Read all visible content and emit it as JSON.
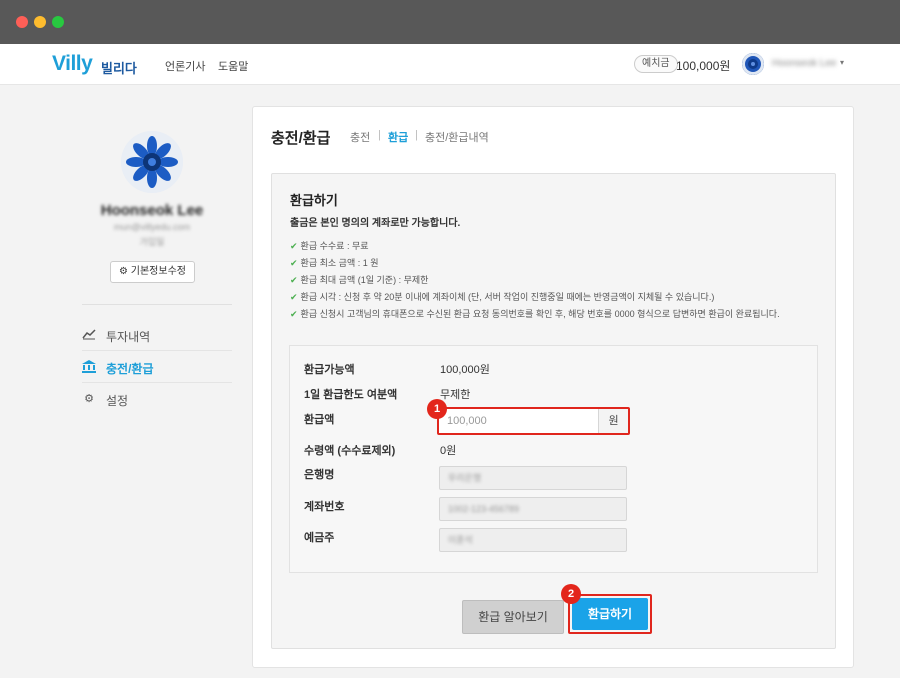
{
  "nav": {
    "logo": "Villy",
    "logo_sub": "빌리다",
    "links": [
      "언론기사",
      "도움말"
    ],
    "deposit_label": "예치금",
    "deposit_amount": "100,000원",
    "username": "Hoonseok Lee",
    "caret": "▾"
  },
  "sidebar": {
    "name": "Hoonseok Lee",
    "email": "mun@villyedu.com",
    "phone": "가입일",
    "edit_button": "기본정보수정",
    "menu": [
      {
        "label": "투자내역",
        "icon": "chart-icon"
      },
      {
        "label": "충전/환급",
        "icon": "bank-icon",
        "active": true
      },
      {
        "label": "설정",
        "icon": "gear-icon"
      }
    ]
  },
  "panel": {
    "title": "충전/환급",
    "tabs": [
      "충전",
      "환급",
      "충전/환급내역"
    ],
    "active_tab": "환급"
  },
  "refund": {
    "title": "환급하기",
    "notice": "출금은 본인 명의의 계좌로만 가능합니다.",
    "rules": [
      "환급 수수료 : 무료",
      "환급 최소 금액 : 1 원",
      "환급 최대 금액 (1일 기준) : 무제한",
      "환급 시각 : 신청 후 약 20분 이내에 계좌이체 (단, 서버 작업이 진행중일 때에는 반영금액이 지체될 수 있습니다.)",
      "환급 신청시 고객님의 휴대폰으로 수신된 환급 요청 동의번호를 확인 후, 해당 번호를 0000 형식으로 답변하면 환급이 완료됩니다."
    ],
    "form": {
      "available_label": "환급가능액",
      "available_value": "100,000원",
      "limit_label": "1일 환급한도 여분액",
      "limit_value": "무제한",
      "amount_label": "환급액",
      "amount_placeholder": "100,000",
      "amount_unit": "원",
      "received_label": "수령액 (수수료제외)",
      "received_value": "0원",
      "bank_label": "은행명",
      "bank_value": "우리은행",
      "account_label": "계좌번호",
      "account_value": "1002-123-456789",
      "holder_label": "예금주",
      "holder_value": "이훈석"
    },
    "buttons": {
      "info": "환급 알아보기",
      "submit": "환급하기"
    },
    "badges": [
      "1",
      "2"
    ]
  },
  "colors": {
    "brand": "#1e9fd8",
    "highlight": "#e0261d",
    "primary_button": "#1aa3e8"
  }
}
